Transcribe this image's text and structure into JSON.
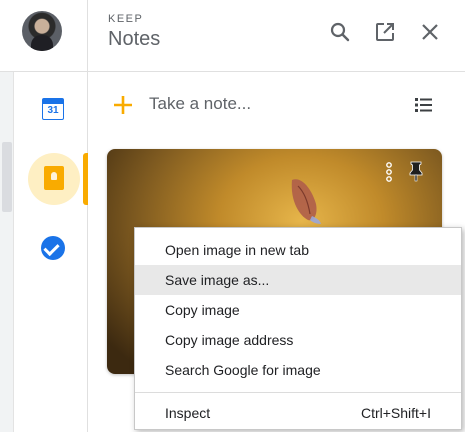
{
  "app": {
    "brand_small": "KEEP",
    "title": "Notes"
  },
  "side_rail": {
    "calendar_day": "31",
    "items": [
      "calendar-icon",
      "keep-icon",
      "tasks-icon"
    ],
    "active_item": "keep-icon"
  },
  "header": {
    "icons": [
      "search-icon",
      "open-in-new-icon",
      "close-icon"
    ]
  },
  "composer": {
    "placeholder": "Take a note...",
    "icons": [
      "plus-icon",
      "list-icon"
    ]
  },
  "note_card": {
    "icons": [
      "more-vert-icon",
      "pin-icon"
    ]
  },
  "context_menu": {
    "items": [
      {
        "label": "Open image in new tab",
        "shortcut": ""
      },
      {
        "label": "Save image as...",
        "shortcut": ""
      },
      {
        "label": "Copy image",
        "shortcut": ""
      },
      {
        "label": "Copy image address",
        "shortcut": ""
      },
      {
        "label": "Search Google for image",
        "shortcut": ""
      },
      {
        "label": "Inspect",
        "shortcut": "Ctrl+Shift+I"
      }
    ],
    "highlighted_index": 1
  },
  "colors": {
    "accent_yellow": "#f9ab00",
    "accent_yellow_light": "#feefc3",
    "google_blue": "#1a73e8",
    "icon_gray": "#5f6368",
    "menu_hover": "#e8e8e8"
  }
}
